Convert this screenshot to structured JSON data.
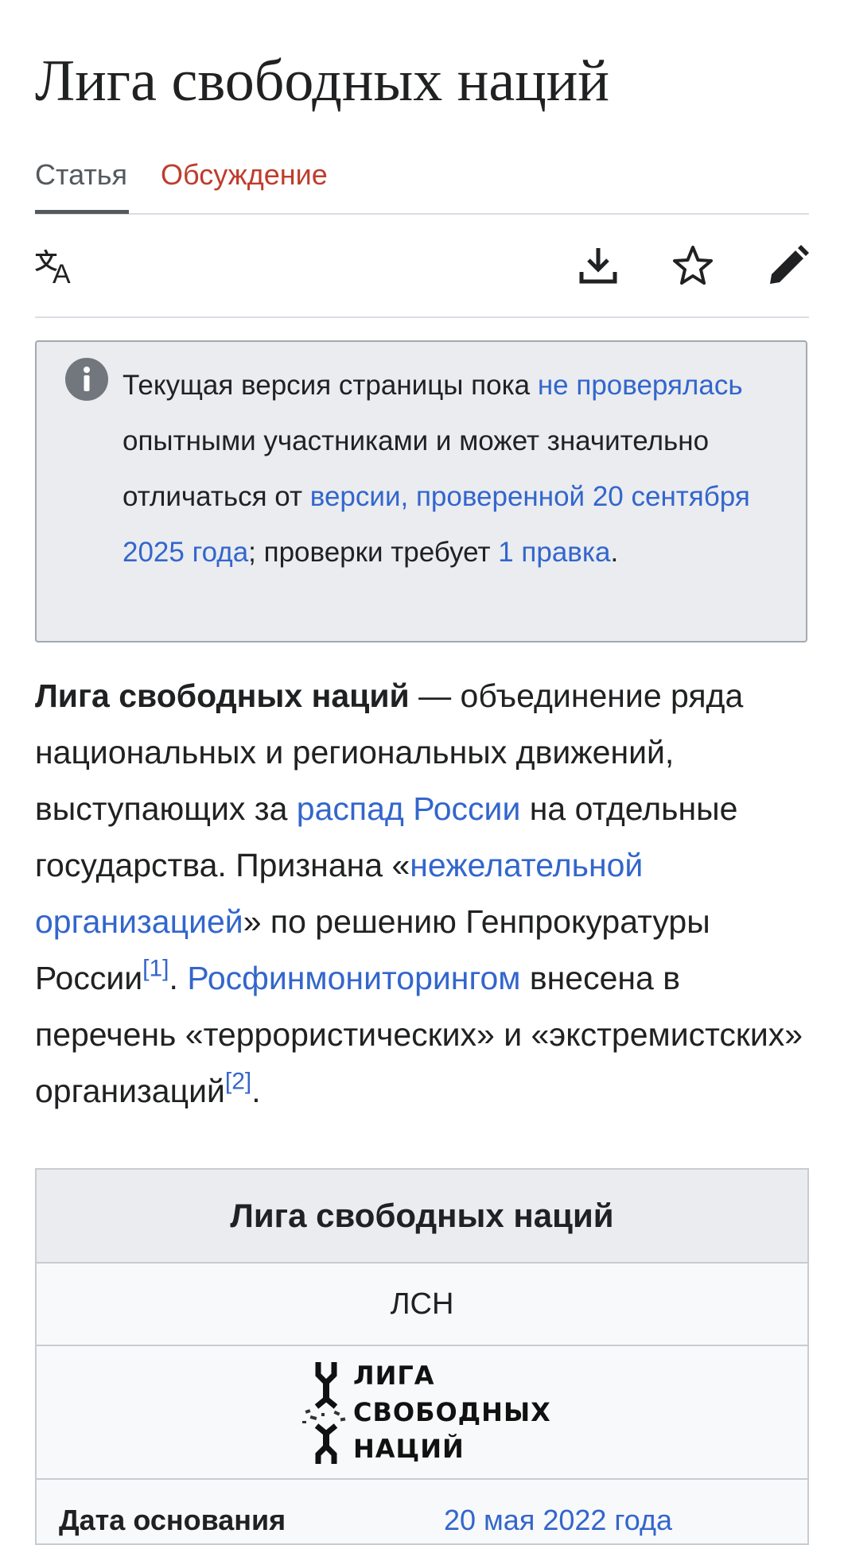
{
  "page": {
    "title": "Лига свободных наций"
  },
  "tabs": [
    {
      "label": "Статья",
      "active": true
    },
    {
      "label": "Обсуждение",
      "active": false
    }
  ],
  "toolbar": {
    "icons": [
      "language-icon",
      "download-icon",
      "star-icon",
      "edit-pencil-icon"
    ]
  },
  "notice": {
    "icon": "info-icon",
    "text_1": "Текущая версия страницы пока ",
    "link_1": "не проверялась",
    "text_2": " опытными участниками и может значительно отличаться от ",
    "link_2": "версии, проверенной 20 сентября 2025 года",
    "text_3": "; проверки требует ",
    "link_3": "1 правка",
    "text_4": "."
  },
  "lead": {
    "bold": "Лига свободных наций",
    "t1": " — объединение ряда национальных и региональных движений, выступающих за ",
    "link_1": "распад России",
    "t2": " на отдельные государства. Признана «",
    "link_2": "нежелательной организацией",
    "t3": "» по решению Генпрокуратуры России",
    "ref_1": "[1]",
    "t4": ". ",
    "link_3": "Росфинмониторингом",
    "t5": " внесена в перечень «террористических» и «экстремистских» организаций",
    "ref_2": "[2]",
    "t6": "."
  },
  "infobox": {
    "title": "Лига свободных наций",
    "abbr": "ЛСН",
    "logo_lines": [
      "ЛИГА",
      "СВОБОДНЫХ",
      "НАЦИЙ"
    ],
    "row_label": "Дата основания",
    "row_value": "20 мая 2022 года"
  },
  "colors": {
    "link": "#3366cc",
    "talk_tab": "#bf3c2c",
    "notice_bg": "#eaecf0"
  }
}
